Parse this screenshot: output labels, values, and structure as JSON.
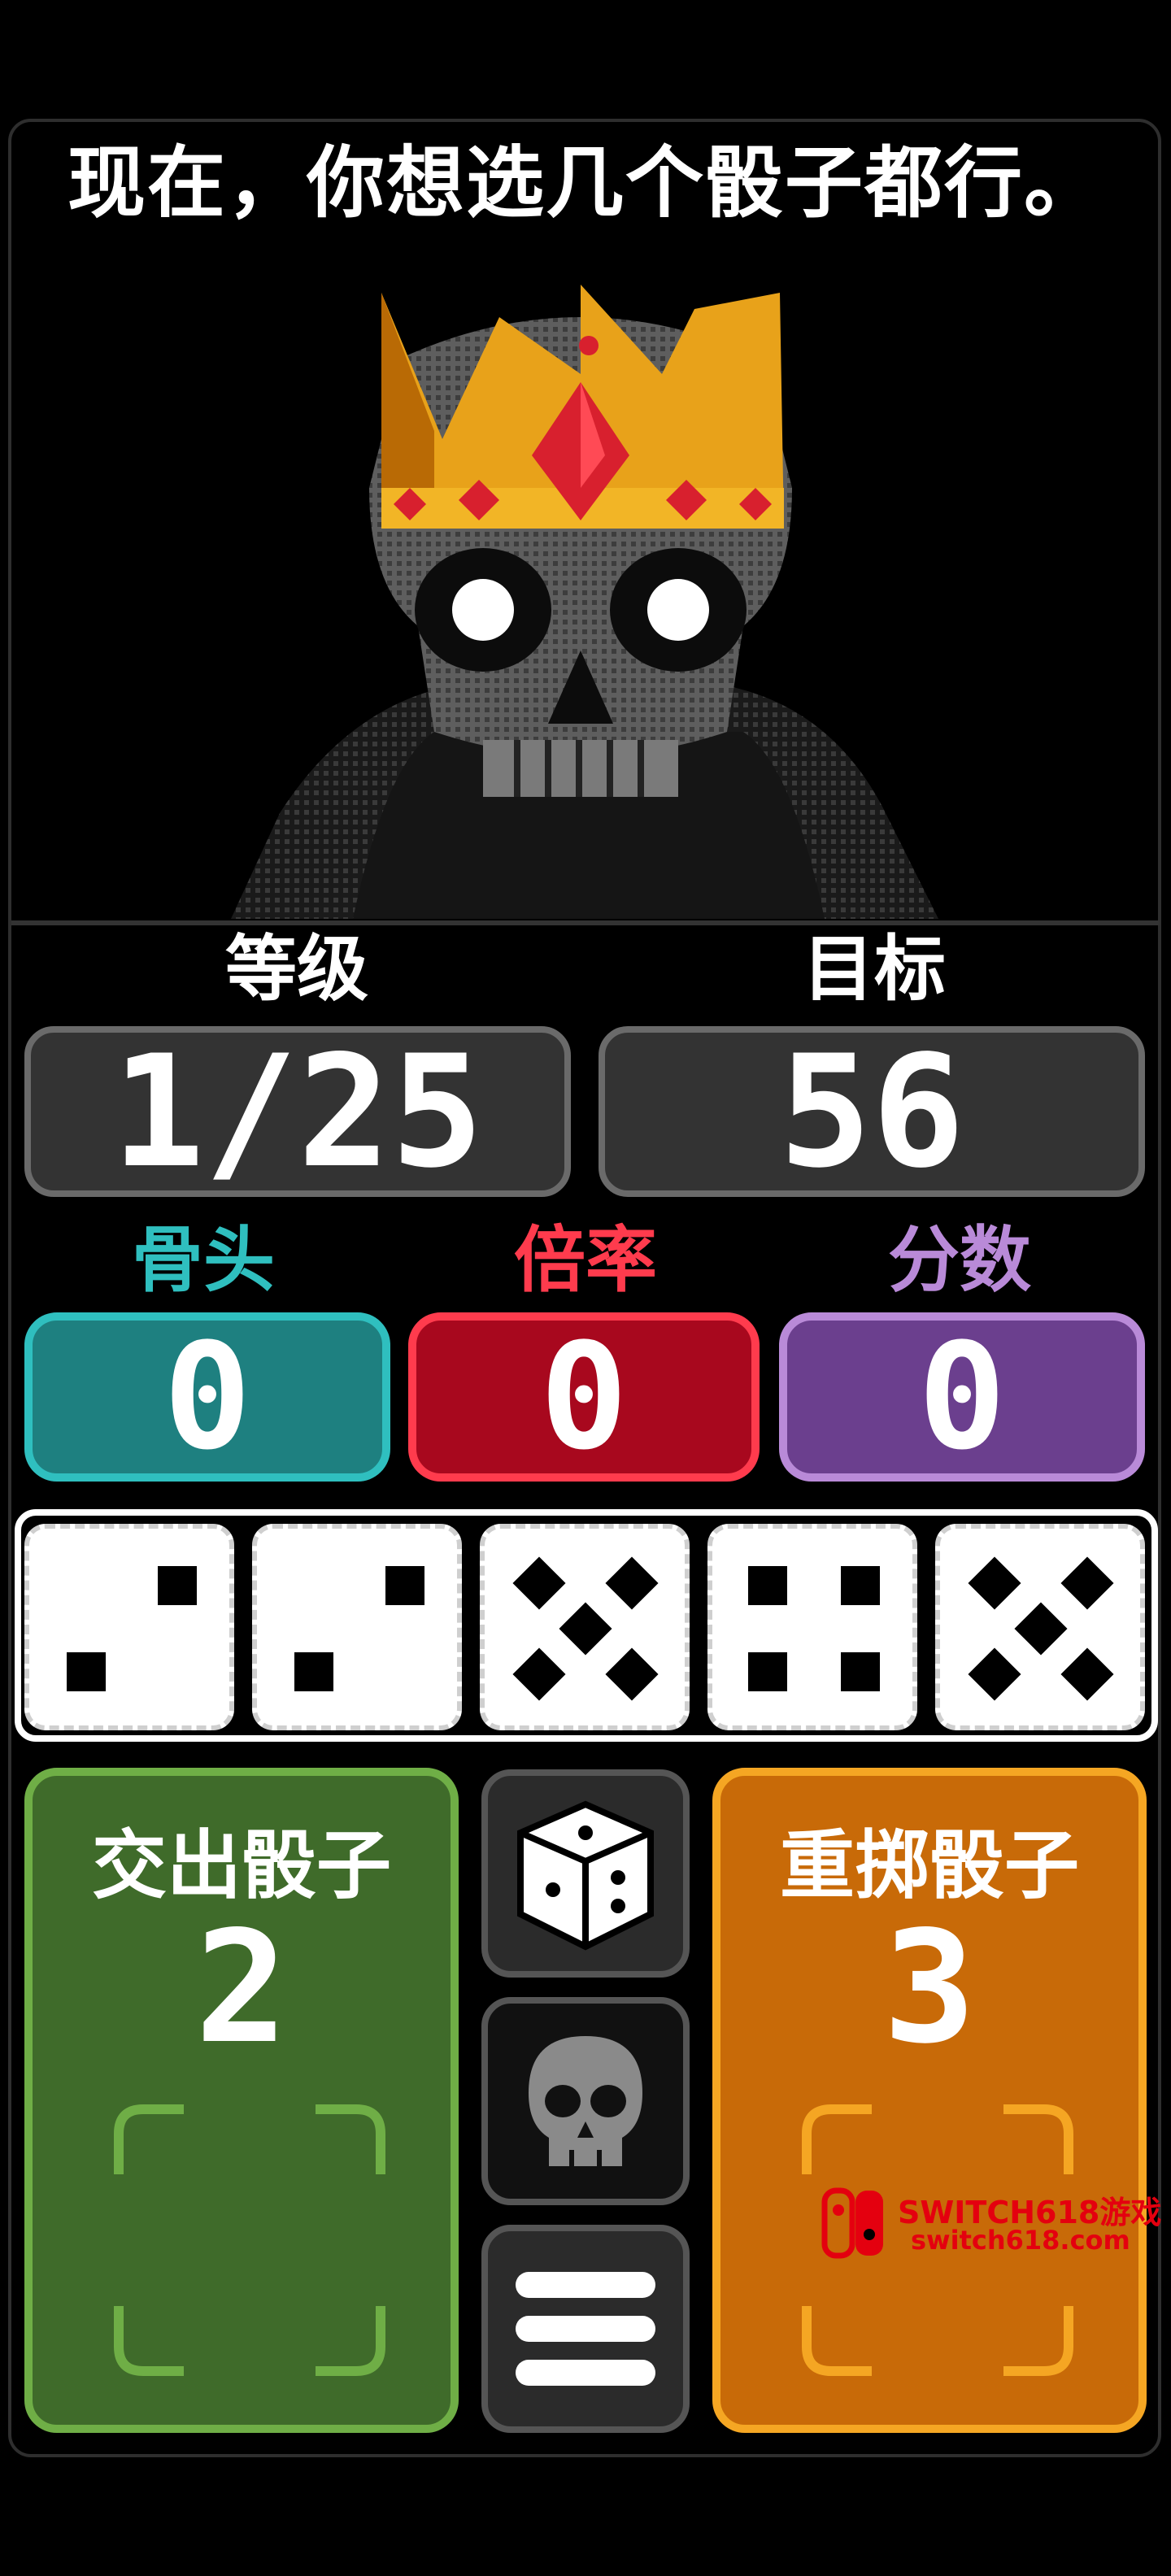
{
  "dialog": {
    "text": "现在，你想选几个骰子都行。"
  },
  "portrait": {
    "subject": "crowned-skull-king"
  },
  "stats": {
    "level_label": "等级",
    "level_value": "1/25",
    "target_label": "目标",
    "target_value": "56"
  },
  "meters": {
    "bones": {
      "label": "骨头",
      "value": "0",
      "color": "#1e8080",
      "text_color": "#2fbfbf"
    },
    "multiplier": {
      "label": "倍率",
      "value": "0",
      "color": "#a8081e",
      "text_color": "#ff3b4d"
    },
    "score": {
      "label": "分数",
      "value": "0",
      "color": "#6b3f8e",
      "text_color": "#b98ad8"
    }
  },
  "dice": [
    {
      "face": 2
    },
    {
      "face": 2
    },
    {
      "face": 5
    },
    {
      "face": 4
    },
    {
      "face": 5
    }
  ],
  "actions": {
    "submit": {
      "label": "交出骰子",
      "count": "2",
      "color": "#3f6b2a",
      "border": "#6fae46"
    },
    "reroll": {
      "label": "重掷骰子",
      "count": "3",
      "color": "#c86a08",
      "border": "#f5a623"
    }
  },
  "side_buttons": [
    {
      "icon": "dice-icon"
    },
    {
      "icon": "skull-icon"
    },
    {
      "icon": "menu-icon"
    }
  ],
  "watermark": {
    "brand": "SWITCH618游戏",
    "url": "switch618.com"
  }
}
